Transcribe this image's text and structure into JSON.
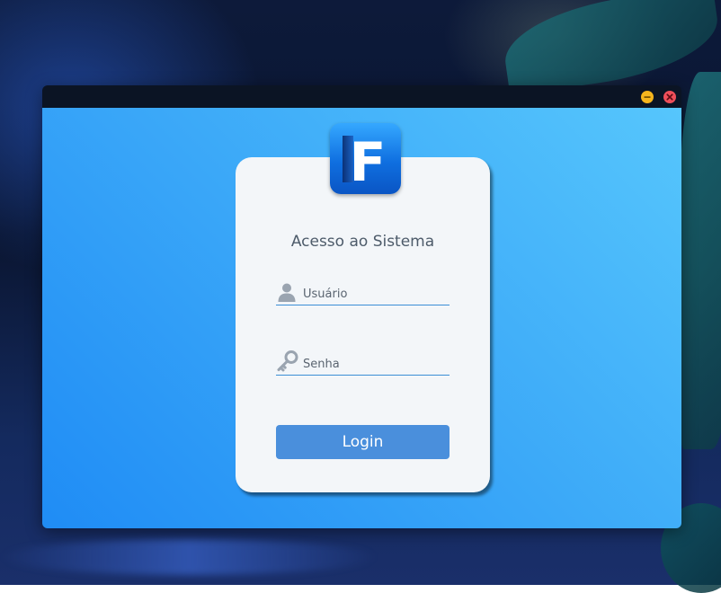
{
  "window": {
    "icons": {
      "minimize": "minimize-icon",
      "close": "close-icon"
    },
    "colors": {
      "titlebar": "#0b1424",
      "minimize": "#f5b51d",
      "close": "#ef4f5a"
    }
  },
  "login": {
    "logo_letter": "F",
    "title": "Acesso ao Sistema",
    "username": {
      "placeholder": "Usuário",
      "value": "",
      "icon": "user-icon"
    },
    "password": {
      "placeholder": "Senha",
      "value": "",
      "icon": "key-icon"
    },
    "button_label": "Login",
    "colors": {
      "background_start": "#1f8cf5",
      "background_end": "#56c6fc",
      "card": "#f3f6f9",
      "button": "#4a8fdc",
      "underline": "#3a8ed6",
      "title_text": "#4d5b6a"
    }
  }
}
